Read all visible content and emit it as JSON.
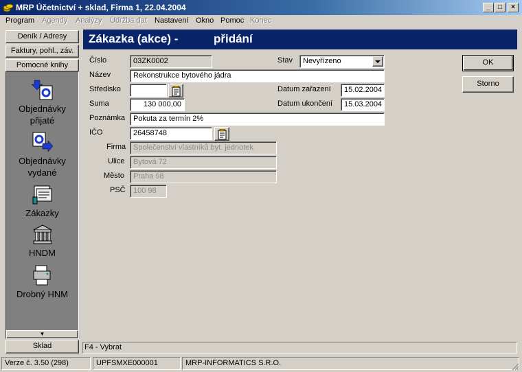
{
  "window": {
    "title": "MRP Účetnictví + sklad, Firma 1, 22.04.2004",
    "controls": {
      "minimize": "_",
      "maximize": "□",
      "close": "×"
    }
  },
  "menu": [
    "Program",
    "Agendy",
    "Analýzy",
    "Údržba dat",
    "Nastavení",
    "Okno",
    "Pomoc",
    "Konec"
  ],
  "menu_disabled": [
    "Agendy",
    "Analýzy",
    "Údržba dat",
    "Konec"
  ],
  "sidebar": {
    "top_buttons": [
      "Deník / Adresy",
      "Faktury, pohl., záv.",
      "Pomocné knihy"
    ],
    "items": [
      {
        "label_line1": "Objednávky",
        "label_line2": "přijaté",
        "icon": "order-received-icon"
      },
      {
        "label_line1": "Objednávky",
        "label_line2": "vydané",
        "icon": "order-issued-icon"
      },
      {
        "label_line1": "Zákazky",
        "label_line2": "",
        "icon": "contracts-icon"
      },
      {
        "label_line1": "HNDM",
        "label_line2": "",
        "icon": "building-icon"
      },
      {
        "label_line1": "Drobný HNM",
        "label_line2": "",
        "icon": "small-asset-icon"
      }
    ],
    "bottom_button": "Sklad",
    "scroll_arrow": "▼"
  },
  "form": {
    "header_title": "Zákazka (akce) -",
    "header_mode": "přidání",
    "labels": {
      "cislo": "Číslo",
      "nazev": "Název",
      "stredisko": "Středisko",
      "suma": "Suma",
      "poznamka": "Poznámka",
      "ico": "IČO",
      "firma": "Firma",
      "ulice": "Ulice",
      "mesto": "Město",
      "psc": "PSČ",
      "stav": "Stav",
      "datum_zarazeni": "Datum zařazení",
      "datum_ukonceni": "Datum ukončení"
    },
    "values": {
      "cislo": "03ZK0002",
      "nazev": "Rekonstrukce bytového jádra",
      "stredisko": "",
      "suma": "130 000,00",
      "poznamka": "Pokuta za termín 2%",
      "ico": "26458748",
      "firma": "Společenství vlastníků byt. jednotek",
      "ulice": "Bytová 72",
      "mesto": "Praha 98",
      "psc": "100 98",
      "stav": "Nevyřízeno",
      "datum_zarazeni": "15.02.2004",
      "datum_ukonceni": "15.03.2004"
    },
    "buttons": {
      "ok": "OK",
      "storno": "Storno"
    }
  },
  "hint_bar": "F4 - Vybrat",
  "status": {
    "version": "Verze č. 3.50 (298)",
    "license": "UPFSMXE000001",
    "company": "MRP-INFORMATICS S.R.O."
  },
  "colors": {
    "header_bg": "#0a246a",
    "window_bg": "#d4d0c8",
    "sidebar_bg": "#808080"
  }
}
